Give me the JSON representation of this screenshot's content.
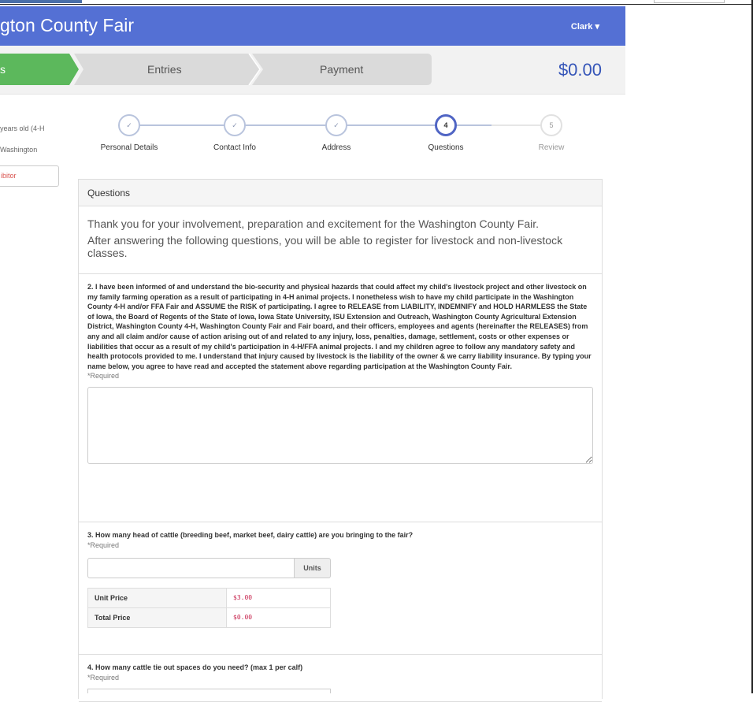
{
  "navbar": {
    "title": "gton County Fair",
    "user": "Clark ▾"
  },
  "stepsbar": {
    "first_label": "s",
    "tabs": [
      "Entries",
      "Payment"
    ],
    "amount": "$0.00",
    "colors": {
      "done": "#5cb85c",
      "pending": "#dadada"
    }
  },
  "left": {
    "line1": "years old (4-H",
    "line2": "Washington",
    "button": "ibitor"
  },
  "wizard": {
    "steps": [
      {
        "label": "Personal Details",
        "state": "done",
        "mark": "✓"
      },
      {
        "label": "Contact Info",
        "state": "done",
        "mark": "✓"
      },
      {
        "label": "Address",
        "state": "done",
        "mark": "✓"
      },
      {
        "label": "Questions",
        "state": "current",
        "mark": "4"
      },
      {
        "label": "Review",
        "state": "todo",
        "mark": "5"
      }
    ]
  },
  "panel": {
    "heading": "Questions",
    "intro1": "Thank you for your involvement, preparation and excitement for the Washington County Fair.",
    "intro2": "After answering the following questions, you will be able to register for livestock and non-livestock classes."
  },
  "q2": {
    "text": "2. I have been informed of and understand the bio-security and physical hazards that could affect my child's livestock project and other livestock on my family farming operation as a result of participating in 4-H animal projects.  I nonetheless wish to have my child participate in the Washington County 4-H and/or FFA Fair and ASSUME the RISK of participating.  I agree to RELEASE from LIABILITY, INDEMNIFY and HOLD HARMLESS the State of Iowa, the Board of Regents of the State of Iowa, Iowa State University, ISU Extension and Outreach, Washington County Agricultural Extension District, Washington County 4-H, Washington County Fair and Fair board, and their officers, employees and agents (hereinafter the RELEASES) from any and all claim and/or cause of action arising out of and related to any injury, loss, penalties, damage, settlement, costs or other expenses or liabilities that occur as a result of my child's participation in 4-H/FFA animal projects.  I and my children agree to follow any mandatory safety and health protocols provided to me. I understand that injury caused by livestock is the liability of the owner & we carry liability insurance. By typing your name below, you agree to have read and accepted the statement above regarding participation at the Washington County Fair.",
    "required": "*Required"
  },
  "q3": {
    "text": "3. How many head of cattle (breeding beef, market beef, dairy cattle) are you bringing to the fair?",
    "required": "*Required",
    "addon": "Units",
    "unit_price_label": "Unit Price",
    "unit_price": "$3.00",
    "total_price_label": "Total Price",
    "total_price": "$0.00"
  },
  "q4": {
    "text": "4. How many cattle tie out spaces do you need? (max 1 per calf)",
    "required": "*Required"
  }
}
